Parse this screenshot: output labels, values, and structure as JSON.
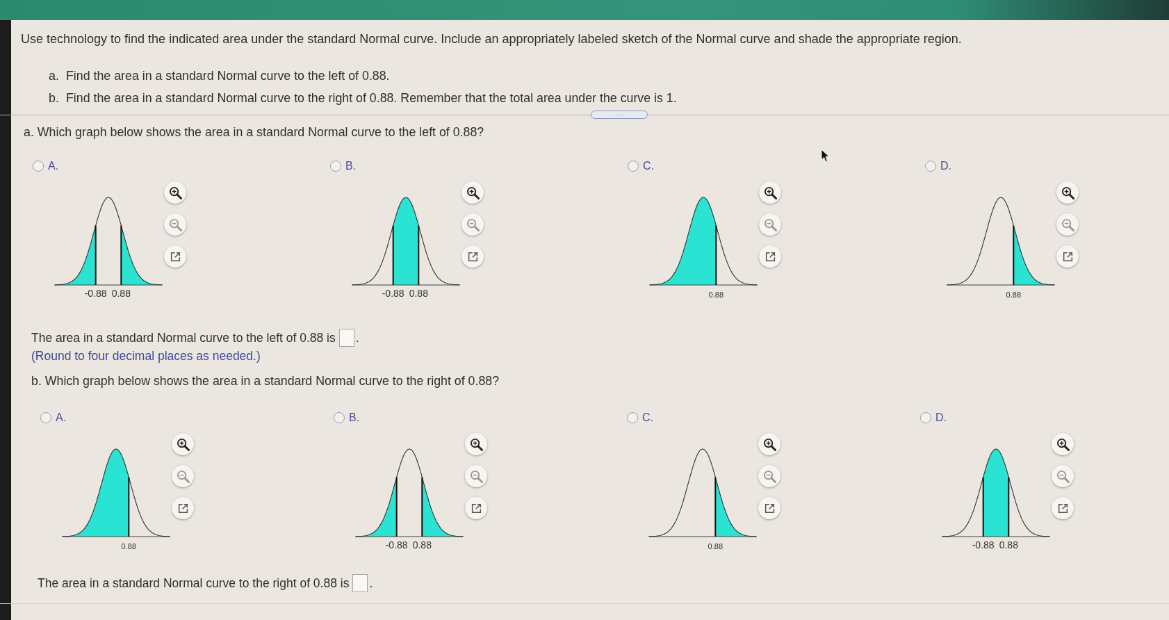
{
  "question": {
    "text": "Use technology to find the indicated area under the standard Normal curve. Include an appropriately labeled sketch of the Normal curve and shade the appropriate region.",
    "parts": [
      {
        "label": "a.",
        "text": "Find the area in a standard Normal curve to the left of 0.88."
      },
      {
        "label": "b.",
        "text": "Find the area in a standard Normal curve to the right of 0.88. Remember that the total area under the curve is 1."
      }
    ]
  },
  "expand_handle": {
    "label": "....."
  },
  "sections": [
    {
      "prompt": "a. Which graph below shows the area in a standard Normal curve to the left of 0.88?",
      "options": [
        {
          "letter": "A.",
          "selected": false,
          "kind": "two-tails",
          "labels": [
            "-0.88",
            "0.88"
          ],
          "zoom_out_disabled": true
        },
        {
          "letter": "B.",
          "selected": false,
          "kind": "middle",
          "labels": [
            "-0.88",
            "0.88"
          ],
          "zoom_out_disabled": true
        },
        {
          "letter": "C.",
          "selected": false,
          "kind": "left",
          "labels": [
            "0.88"
          ],
          "zoom_out_disabled": true
        },
        {
          "letter": "D.",
          "selected": false,
          "kind": "right",
          "labels": [
            "0.88"
          ],
          "zoom_out_disabled": true
        }
      ],
      "answer": {
        "text": "The area in a standard Normal curve to the left of 0.88 is",
        "after": "."
      },
      "note": "(Round to four decimal places as needed.)"
    },
    {
      "prompt": "b. Which graph below shows the area in a standard Normal curve to the right of 0.88?",
      "options": [
        {
          "letter": "A.",
          "selected": false,
          "kind": "left",
          "labels": [
            "0.88"
          ],
          "zoom_out_disabled": true
        },
        {
          "letter": "B.",
          "selected": false,
          "kind": "two-tails",
          "labels": [
            "-0.88",
            "0.88"
          ],
          "zoom_out_disabled": true
        },
        {
          "letter": "C.",
          "selected": false,
          "kind": "right",
          "labels": [
            "0.88"
          ],
          "zoom_out_disabled": true
        },
        {
          "letter": "D.",
          "selected": false,
          "kind": "middle",
          "labels": [
            "-0.88",
            "0.88"
          ],
          "zoom_out_disabled": true
        }
      ],
      "answer": {
        "text": "The area in a standard Normal curve to the right of 0.88 is",
        "after": "."
      }
    }
  ]
}
